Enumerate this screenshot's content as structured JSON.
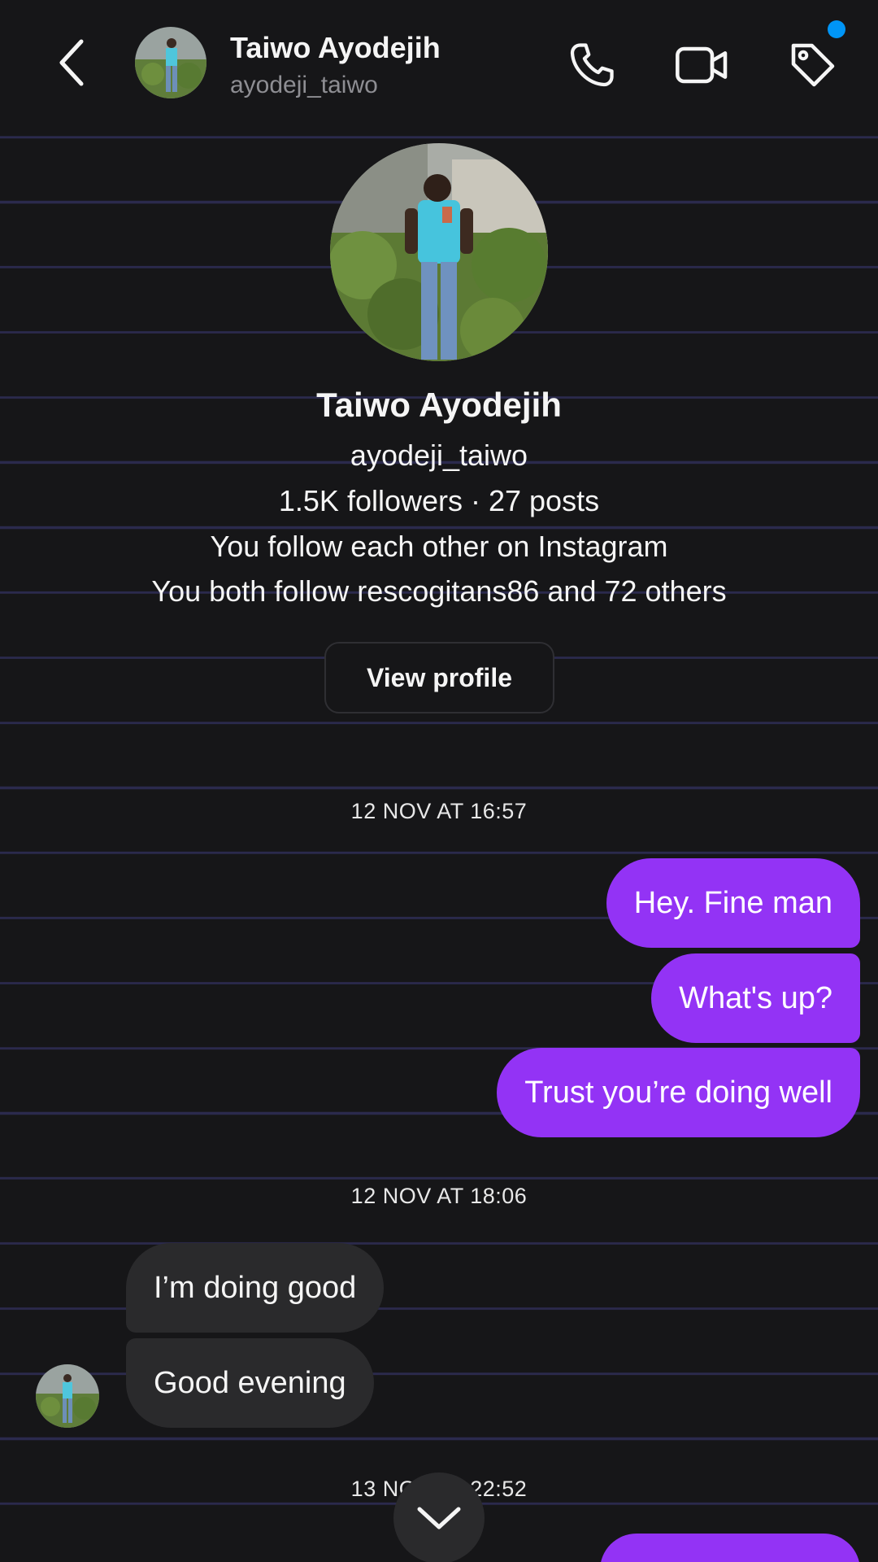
{
  "header": {
    "name": "Taiwo Ayodejih",
    "username": "ayodeji_taiwo",
    "icons": [
      "back-icon",
      "phone-icon",
      "video-camera-icon",
      "tag-icon"
    ]
  },
  "profile": {
    "name": "Taiwo Ayodejih",
    "username": "ayodeji_taiwo",
    "stats": "1.5K followers · 27 posts",
    "mutual_status": "You follow each other on Instagram",
    "mutual_followers": "You both follow rescogitans86 and 72 others",
    "view_profile_label": "View profile"
  },
  "conversation": {
    "timestamps": [
      "12 NOV AT 16:57",
      "12 NOV AT 18:06",
      "13 NOV AT 22:52"
    ],
    "sent_1": [
      "Hey. Fine man",
      "What's up?",
      "Trust you’re doing well"
    ],
    "received_1": [
      "I’m doing good",
      "Good evening"
    ]
  },
  "colors": {
    "background": "#161618",
    "sent_bubble": "#9333f5",
    "received_bubble": "#2a2a2c",
    "notification_dot": "#0095f6",
    "stripe": "#2b2a4d"
  }
}
